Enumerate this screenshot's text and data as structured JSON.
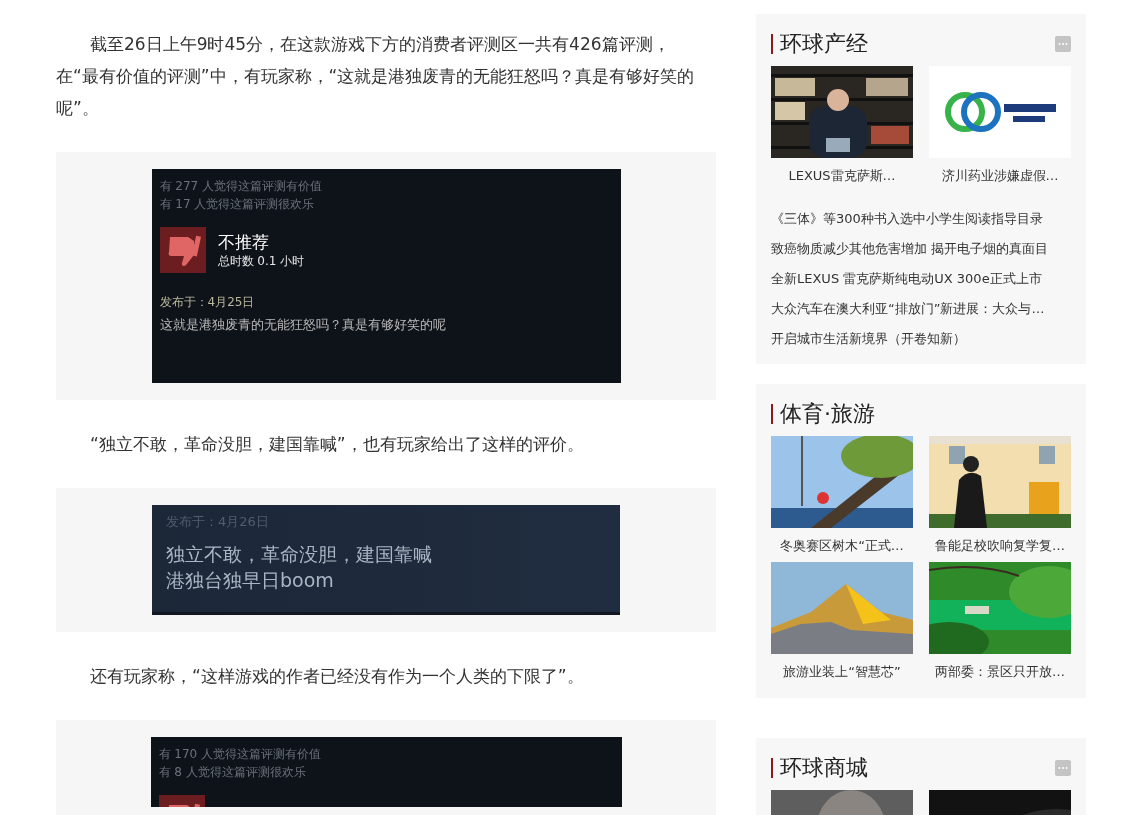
{
  "article": [
    {
      "kind": "paragraph",
      "text": "截至26日上午9时45分，在这款游戏下方的消费者评测区一共有426篇评测，在“最有价值的评测”中，有玩家称，“这就是港独废青的无能狂怒吗？真是有够好笑的呢”。"
    },
    {
      "kind": "review",
      "helpful": "有 277 人觉得这篇评测有价值",
      "funny": "有 17 人觉得这篇评测很欢乐",
      "verdict": "不推荐",
      "hours": "总时数 0.1 小时",
      "date": "发布于：4月25日",
      "lines": [
        "这就是港独废青的无能狂怒吗？真是有够好笑的呢"
      ]
    },
    {
      "kind": "paragraph",
      "text": "“独立不敢，革命没胆，建国靠喊”，也有玩家给出了这样的评价。"
    },
    {
      "kind": "review_text",
      "date": "发布于：4月26日",
      "lines": [
        "独立不敢，革命没胆，建国靠喊",
        "港独台独早日boom"
      ]
    },
    {
      "kind": "paragraph",
      "text": "还有玩家称，“这样游戏的作者已经没有作为一个人类的下限了”。"
    },
    {
      "kind": "review_partial",
      "helpful": "有 170 人觉得这篇评测有价值",
      "funny": "有 8 人觉得这篇评测很欢乐"
    }
  ],
  "sidebar": [
    {
      "title": "环球产经",
      "more": true,
      "tiles": [
        {
          "kind": "picture",
          "caption": "LEXUS雷克萨斯…"
        },
        {
          "kind": "picture",
          "caption": "济川药业涉嫌虚假…"
        }
      ],
      "links": [
        "《三体》等300种书入选中小学生阅读指导目录",
        "致癌物质减少其他危害增加 揭开电子烟的真面目",
        "全新LEXUS 雷克萨斯纯电动UX 300e正式上市",
        "大众汽车在澳大利亚“排放门”新进展：大众与…",
        "开启城市生活新境界（开卷知新）"
      ]
    },
    {
      "title": "体育·旅游",
      "more": false,
      "tiles": [
        {
          "kind": "picture",
          "caption": "冬奥赛区树木“正式…"
        },
        {
          "kind": "picture",
          "caption": "鲁能足校吹响复学复…"
        },
        {
          "kind": "picture",
          "caption": "旅游业装上“智慧芯”"
        },
        {
          "kind": "picture",
          "caption": "两部委：景区只开放…"
        }
      ]
    },
    {
      "kind": "blank"
    },
    {
      "title": "环球商城",
      "more": true
    }
  ]
}
